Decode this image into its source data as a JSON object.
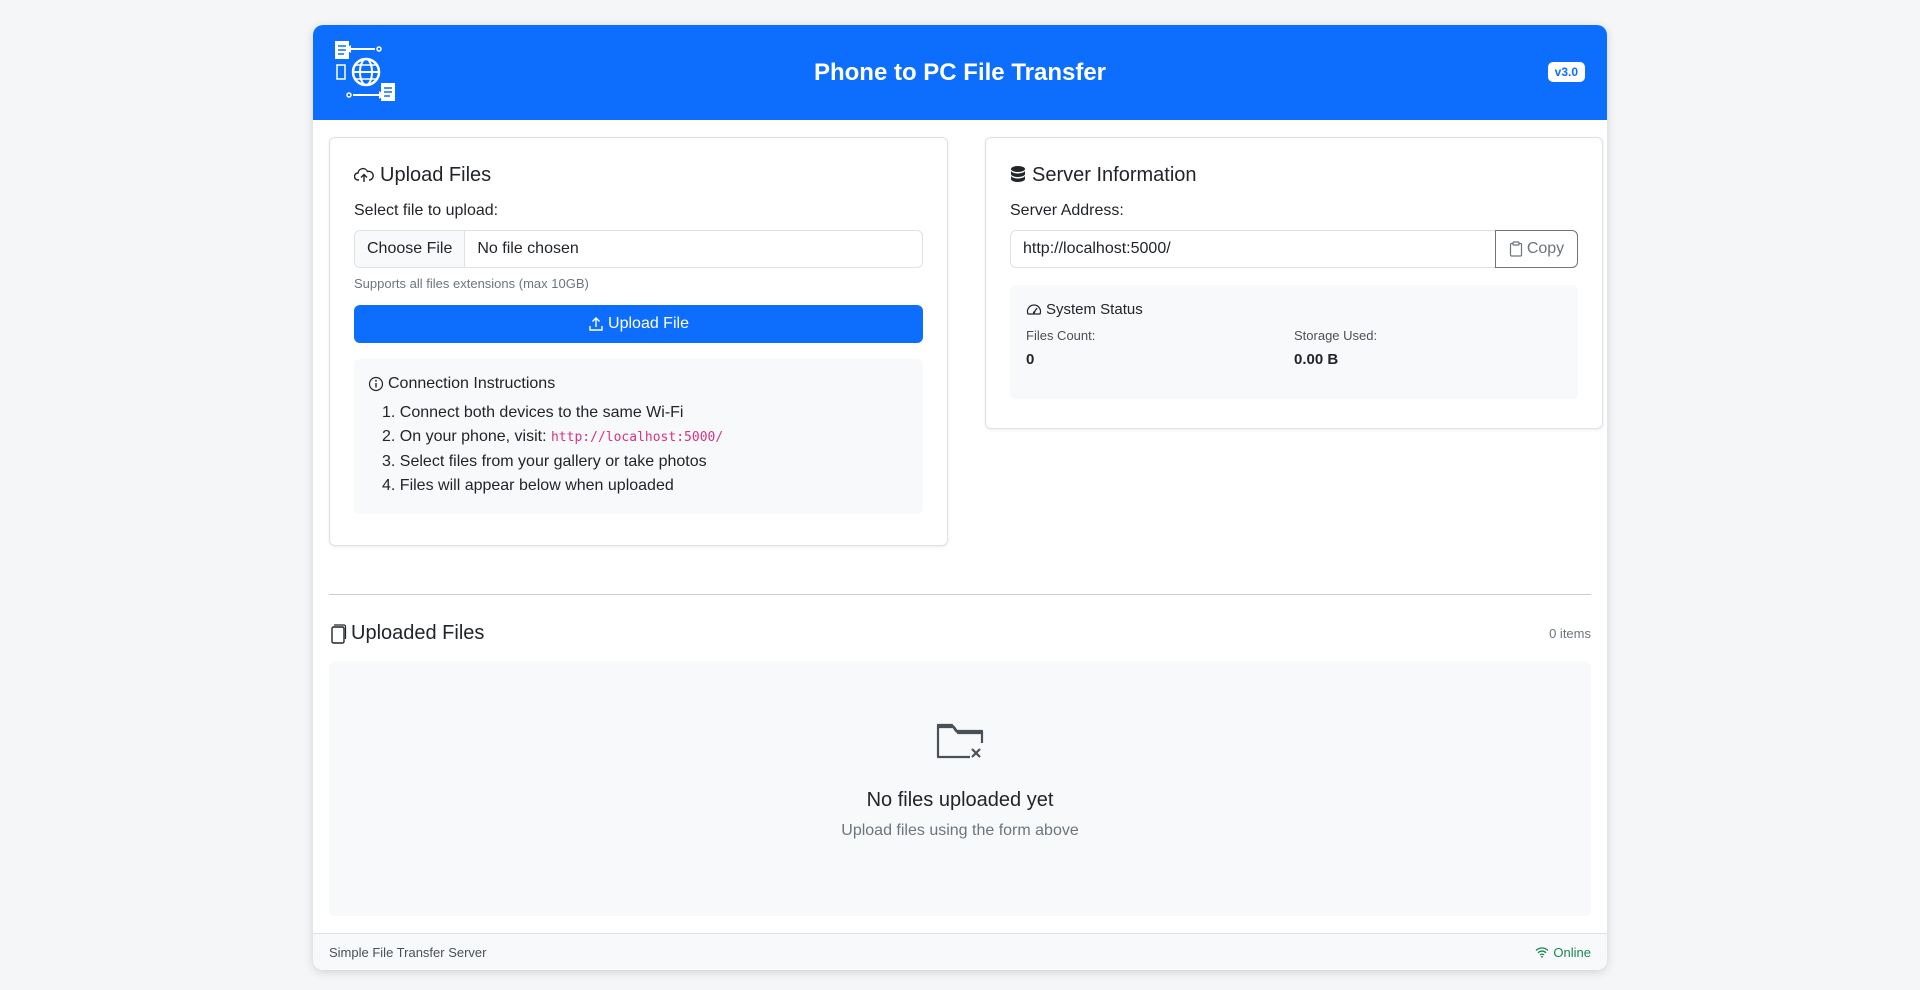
{
  "header": {
    "title": "Phone to PC File Transfer",
    "version": "v3.0"
  },
  "upload": {
    "title": "Upload Files",
    "select_label": "Select file to upload:",
    "choose_button": "Choose File",
    "file_status": "No file chosen",
    "hint": "Supports all files extensions (max 10GB)",
    "upload_button": "Upload File"
  },
  "instructions": {
    "title": "Connection Instructions",
    "items": [
      {
        "num": "1.",
        "text": "Connect both devices to the same Wi-Fi"
      },
      {
        "num": "2.",
        "text": "On your phone, visit: ",
        "code": "http://localhost:5000/"
      },
      {
        "num": "3.",
        "text": "Select files from your gallery or take photos"
      },
      {
        "num": "4.",
        "text": "Files will appear below when uploaded"
      }
    ]
  },
  "server": {
    "title": "Server Information",
    "address_label": "Server Address:",
    "address": "http://localhost:5000/",
    "copy_button": "Copy"
  },
  "status": {
    "title": "System Status",
    "files_count_label": "Files Count:",
    "files_count": "0",
    "storage_label": "Storage Used:",
    "storage": "0.00 B"
  },
  "files": {
    "title": "Uploaded Files",
    "count": "0 items",
    "empty_title": "No files uploaded yet",
    "empty_sub": "Upload files using the form above"
  },
  "footer": {
    "left": "Simple File Transfer Server",
    "status": "Online"
  },
  "colors": {
    "primary": "#0d6efd",
    "success": "#198754",
    "code": "#d63384",
    "muted": "#6c757d"
  }
}
